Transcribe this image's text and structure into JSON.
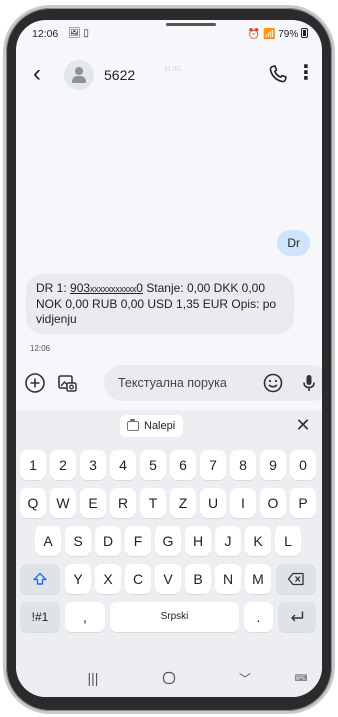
{
  "status_bar": {
    "time": "12:06",
    "battery": "79%"
  },
  "header": {
    "contact_name": "5622",
    "faint_time": "11:41"
  },
  "messages": {
    "sent": {
      "text": "Dr"
    },
    "received": {
      "prefix": "DR 1: ",
      "account_start": "903",
      "account_mask": "xxxxxxxxxxx",
      "account_end": "0",
      "body": " Stanje: 0,00 DKK 0,00 NOK 0,00 RUB 0,00 USD 1,35 EUR Opis: po vidjenju",
      "time": "12:06"
    }
  },
  "composer": {
    "placeholder": "Текстуална порука"
  },
  "keyboard": {
    "paste_label": "Nalepi",
    "row_numbers": [
      "1",
      "2",
      "3",
      "4",
      "5",
      "6",
      "7",
      "8",
      "9",
      "0"
    ],
    "row_q": [
      "Q",
      "W",
      "E",
      "R",
      "T",
      "Z",
      "U",
      "I",
      "O",
      "P"
    ],
    "row_a": [
      "A",
      "S",
      "D",
      "F",
      "G",
      "H",
      "J",
      "K",
      "L"
    ],
    "row_y": [
      "Y",
      "X",
      "C",
      "V",
      "B",
      "N",
      "M"
    ],
    "symbols_label": "!#1",
    "comma_label": ",",
    "space_label": "Srpski",
    "period_label": "."
  },
  "colors": {
    "sent_bubble": "#cfe4fb",
    "received_bubble": "#e9ebf0",
    "keyboard_bg": "#eceef1",
    "accent": "#1a73e8"
  }
}
